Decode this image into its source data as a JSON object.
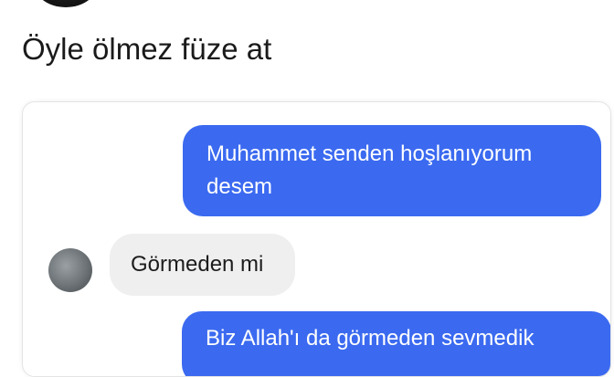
{
  "post": {
    "text": "Öyle ölmez füze at"
  },
  "chat": {
    "messages": [
      {
        "direction": "outgoing",
        "lines": [
          "Muhammet senden hoşlanıyorum",
          "desem"
        ]
      },
      {
        "direction": "incoming",
        "text": "Görmeden mi"
      },
      {
        "direction": "outgoing",
        "text": "Biz Allah'ı da görmeden sevmedik"
      }
    ],
    "colors": {
      "outgoing_bubble": "#3b6af0",
      "incoming_bubble": "#efefef"
    }
  }
}
